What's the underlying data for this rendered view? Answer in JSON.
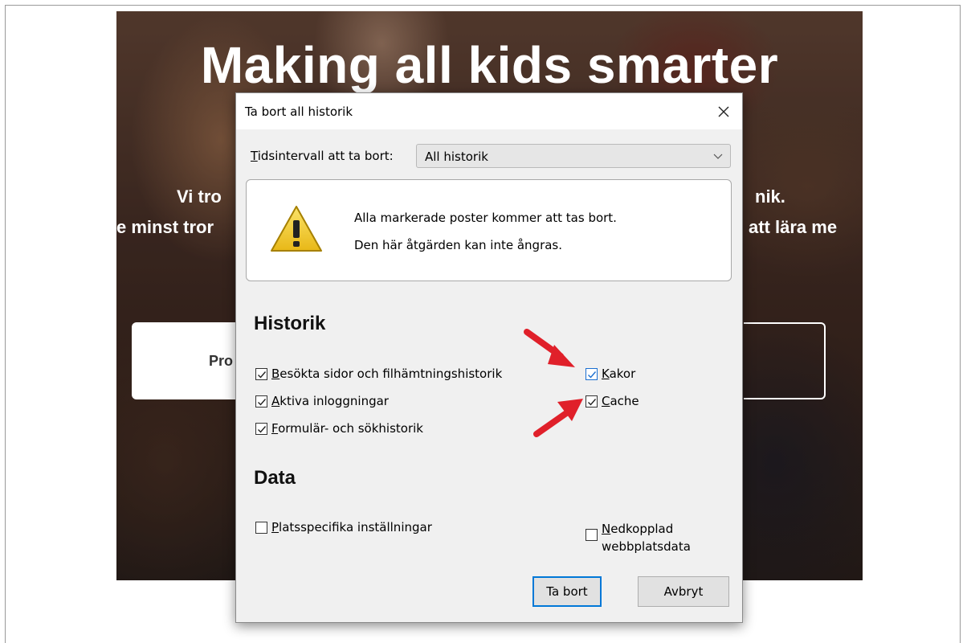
{
  "website": {
    "headline": "Making all kids smarter",
    "line1_left": "Vi tro",
    "line1_right": "nik.",
    "line2_left": "e minst tror",
    "line2_right": "att lära me",
    "button_left_text": "Pro"
  },
  "dialog": {
    "title": "Ta bort all historik",
    "time_range": {
      "label_accel": "T",
      "label_rest": "idsintervall att ta bort:",
      "selected": "All historik"
    },
    "warning": {
      "line1": "Alla markerade poster kommer att tas bort.",
      "line2": "Den här åtgärden kan inte ångras."
    },
    "history_section": {
      "heading": "Historik",
      "items": [
        {
          "accel": "B",
          "rest": "esökta sidor och filhämtningshistorik",
          "checked": true
        },
        {
          "accel": "A",
          "rest": "ktiva inloggningar",
          "checked": true
        },
        {
          "accel": "F",
          "rest": "ormulär- och sökhistorik",
          "checked": true
        },
        {
          "accel": "K",
          "rest": "akor",
          "checked": true
        },
        {
          "accel": "C",
          "rest": "ache",
          "checked": true
        }
      ]
    },
    "data_section": {
      "heading": "Data",
      "items": [
        {
          "accel": "P",
          "rest": "latsspecifika inställningar",
          "checked": false
        },
        {
          "accel": "N",
          "rest": "edkopplad",
          "line2": "webbplatsdata",
          "checked": false
        }
      ]
    },
    "buttons": {
      "primary": "Ta bort",
      "cancel": "Avbryt"
    }
  },
  "colors": {
    "arrow": "#e0202a",
    "focus_border": "#0078d7",
    "dialog_bg": "#f0f0f0"
  }
}
